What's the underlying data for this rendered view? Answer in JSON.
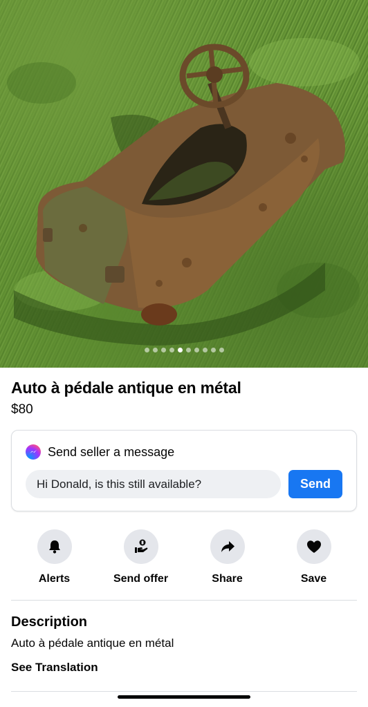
{
  "listing": {
    "photo_description_icon": "pedal-car-photo",
    "photo_count": 10,
    "photo_active_index": 4,
    "title": "Auto à pédale antique en métal",
    "price": "$80"
  },
  "message": {
    "icon": "messenger-icon",
    "heading": "Send seller a message",
    "input_value": "Hi Donald, is this still available?",
    "send_label": "Send",
    "accent": "#1877f2"
  },
  "actions": [
    {
      "label": "Alerts",
      "icon": "bell-icon"
    },
    {
      "label": "Send offer",
      "icon": "offer-icon"
    },
    {
      "label": "Share",
      "icon": "share-icon"
    },
    {
      "label": "Save",
      "icon": "heart-icon"
    }
  ],
  "description": {
    "heading": "Description",
    "text": "Auto à pédale antique en métal",
    "translate_label": "See Translation"
  }
}
